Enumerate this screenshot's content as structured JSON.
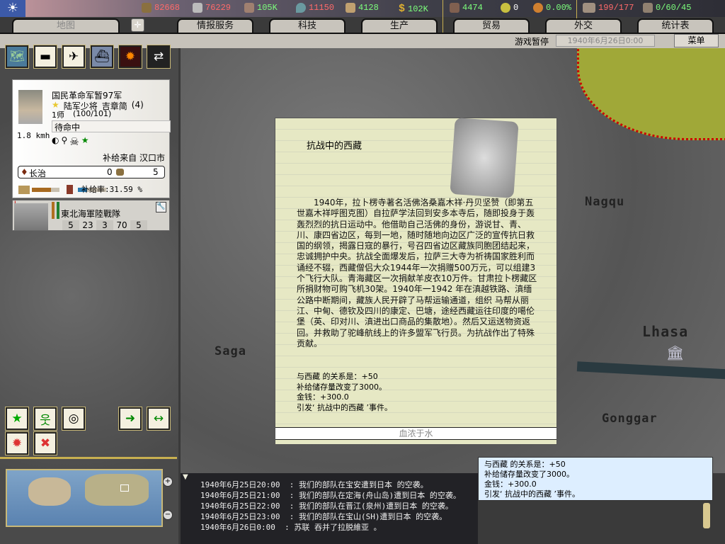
{
  "resources": [
    {
      "name": "energy",
      "value": "82668",
      "color": "#ff6a6a"
    },
    {
      "name": "metal",
      "value": "76229",
      "color": "#ff6a6a"
    },
    {
      "name": "rare-materials",
      "value": "105K",
      "color": "#7cff7c"
    },
    {
      "name": "oil",
      "value": "11150",
      "color": "#ff6a6a"
    },
    {
      "name": "supplies",
      "value": "4128",
      "color": "#7cff7c"
    },
    {
      "name": "money",
      "value": "102K",
      "color": "#7cff7c"
    },
    {
      "name": "manpower",
      "value": "4474",
      "color": "#7cff7c"
    },
    {
      "name": "nuclear",
      "value": "0",
      "color": "#ffffff"
    },
    {
      "name": "dissent",
      "value": "0.00%",
      "color": "#7cff7c"
    },
    {
      "name": "transport",
      "value": "199/177",
      "color": "#ff6a6a"
    },
    {
      "name": "convoys",
      "value": "0/60/45",
      "color": "#7cff7c"
    }
  ],
  "tabs": [
    "地图",
    "情报服务",
    "科技",
    "生产",
    "贸易",
    "外交",
    "统计表"
  ],
  "status": {
    "paused": "游戏暂停",
    "date": "1940年6月26日0:00",
    "menu": "菜单"
  },
  "unit": {
    "name": "国民革命军暂97军",
    "rank": "陆军少将",
    "commander": "吉章简",
    "skill": "(4)",
    "size": "1师",
    "strength": "(100/101)",
    "order": "待命中",
    "speed": "1.8 kmh",
    "supply_from": "补给来自 汉口市",
    "location": "长治",
    "loc_val1": "0",
    "loc_val2": "5",
    "supply_rate": "补给率:31.59 %",
    "supply_rate_fill": 0.3159,
    "org_fill": 0.7
  },
  "subunit": {
    "name": "東北海軍陸戰隊",
    "stats": [
      "5",
      "23",
      "3",
      "70",
      "5"
    ]
  },
  "map_labels": {
    "nagqu": "Nagqu",
    "lhasa": "Lhasa",
    "saga": "Saga",
    "gonggar": "Gonggar"
  },
  "dialog": {
    "title": "抗战中的西藏",
    "body": "1940年，拉卜楞寺著名活佛洛桑嘉木祥·丹贝坚赞（即第五世嘉木祥呼图克图）自拉萨学法回到安多本寺后，随即投身于轰轰烈烈的抗日运动中。他借助自己活佛的身份，游说甘、青、川、康四省边区，每到一地，随时随地向边区广泛的宣传抗日救国的纲领，揭露日寇的暴行，号召四省边区藏族同胞团结起来， 忠诚拥护中央。抗战全面爆发后，拉萨三大寺为祈祷国家胜利而诵经不辍，西藏僧侣大众1944年一次捐赠500万元，可以组建3个飞行大队。青海藏区一次捐献羊皮衣10万件。甘肃拉卜楞藏区所捐财物可购飞机30架。1940年一1942 年在滇越铁路、滇缅公路中断期间，藏族人民开辟了马帮运输通道，组织 马帮从丽江、中甸、德钦及四川的康定、巴塘，途经西藏运往印度的噶伦堡（英、印对川、滇进出口商品的集散地）。然后又运送物资返回。并救助了驼峰航线上的许多盟军飞行员。为抗战作出了特殊贡献。",
    "effects": [
      "与西藏 的关系是：+50",
      "补给储存量改变了3000。",
      "金钱：+300.0",
      "引发‘  抗战中的西藏  ’事件。"
    ],
    "button": "血浓于水"
  },
  "log": [
    "1940年6月25日20:00  : 我们的部队在宝安遭到日本 的空袭。",
    "1940年6月25日21:00  : 我们的部队在定海(舟山岛)遭到日本 的空袭。",
    "1940年6月25日22:00  : 我们的部队在晋江(泉州)遭到日本 的空袭。",
    "1940年6月25日23:00  : 我们的部队在宝山(SH)遭到日本 的空袭。",
    "1940年6月26日0:00  : 苏联 吞并了拉脱維亚 。"
  ],
  "tooltip": [
    "与西藏 的关系是：+50",
    "补给储存量改变了3000。",
    "金钱：+300.0",
    "引发‘  抗战中的西藏  ’事件。"
  ]
}
